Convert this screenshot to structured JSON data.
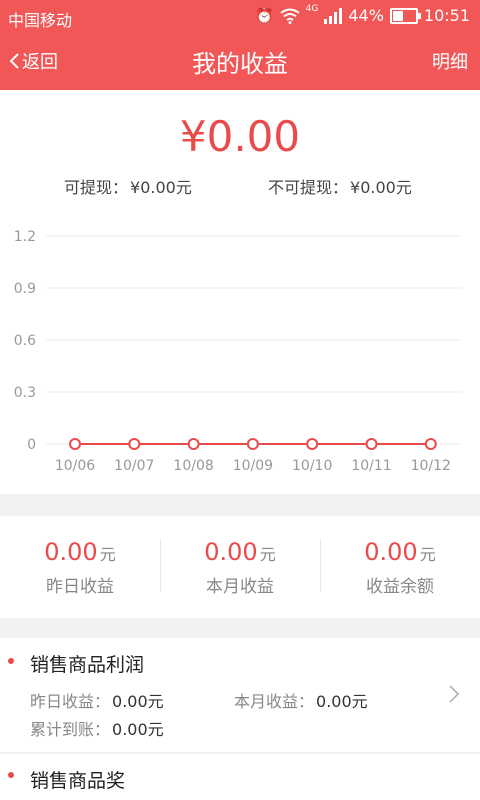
{
  "status_bar": {
    "carrier": "中国移动",
    "network": "4G",
    "battery": "44%",
    "battery_level": 0.44,
    "time": "10:51"
  },
  "header": {
    "back_label": "返回",
    "title": "我的收益",
    "detail_label": "明细"
  },
  "summary": {
    "amount": "¥0.00",
    "withdrawable_label": "可提现：",
    "withdrawable_value": "¥0.00元",
    "non_withdrawable_label": "不可提现：",
    "non_withdrawable_value": "¥0.00元"
  },
  "chart_data": {
    "type": "line",
    "categories": [
      "10/06",
      "10/07",
      "10/08",
      "10/09",
      "10/10",
      "10/11",
      "10/12"
    ],
    "values": [
      0,
      0,
      0,
      0,
      0,
      0,
      0
    ],
    "y_ticks": [
      "1.2",
      "0.9",
      "0.6",
      "0.3",
      "0"
    ],
    "ylim": [
      0,
      1.2
    ],
    "grid": true,
    "color": "#e94b4b"
  },
  "stats": [
    {
      "value": "0.00",
      "unit": "元",
      "label": "昨日收益"
    },
    {
      "value": "0.00",
      "unit": "元",
      "label": "本月收益"
    },
    {
      "value": "0.00",
      "unit": "元",
      "label": "收益余额"
    }
  ],
  "sections": [
    {
      "title": "销售商品利润",
      "yesterday_label": "昨日收益：",
      "yesterday_value": "0.00元",
      "month_label": "本月收益：",
      "month_value": "0.00元",
      "total_label": "累计到账：",
      "total_value": "0.00元"
    },
    {
      "title": "销售商品奖"
    }
  ],
  "colors": {
    "brand": "#f25757",
    "accent": "#e94b4b",
    "background": "#f2f2f2"
  }
}
